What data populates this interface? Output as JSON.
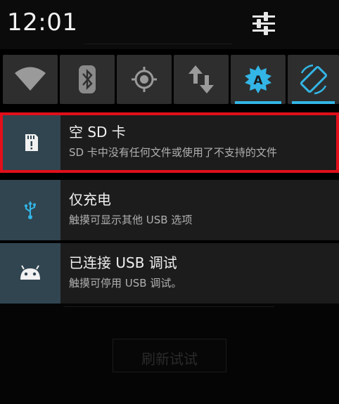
{
  "status": {
    "time": "12:01"
  },
  "quick_settings": {
    "tiles": [
      {
        "icon": "wifi-icon",
        "active": false
      },
      {
        "icon": "bluetooth-icon",
        "active": false
      },
      {
        "icon": "location-icon",
        "active": false
      },
      {
        "icon": "mobile-data-icon",
        "active": false
      },
      {
        "icon": "auto-brightness-icon",
        "active": true,
        "label": "A"
      },
      {
        "icon": "auto-rotate-icon",
        "active": true
      }
    ],
    "accent_color": "#33b5e5"
  },
  "notifications": [
    {
      "icon": "sd-card-icon",
      "title": "空 SD 卡",
      "text": "SD 卡中没有任何文件或使用了不支持的文件"
    },
    {
      "icon": "usb-icon",
      "title": "仅充电",
      "text": "触摸可显示其他 USB 选项"
    },
    {
      "icon": "android-debug-icon",
      "title": "已连接 USB 调试",
      "text": "触摸可停用 USB 调试。"
    }
  ],
  "background_app": {
    "button_label": "刷新试试"
  },
  "highlight_color": "#e10f1b"
}
